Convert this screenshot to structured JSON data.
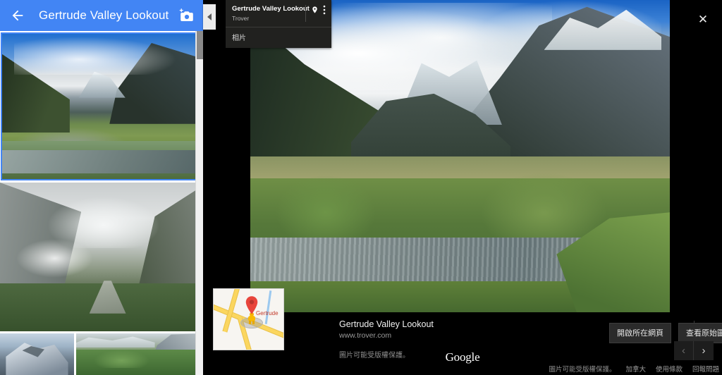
{
  "app": {
    "title": "Gertrude Valley Lookout",
    "back_icon": "back-arrow-icon",
    "add_photo_icon": "add-photo-camera-icon",
    "header_color": "#4285f4"
  },
  "sidebar": {
    "thumbnails": [
      {
        "alt": "Gertrude Valley green alpine valley with stream",
        "selected": true
      },
      {
        "alt": "Misty cliffs and winding road in valley",
        "selected": false
      },
      {
        "alt": "Snow covered mountain peak",
        "selected": false
      },
      {
        "alt": "Beech forest with mountains behind",
        "selected": false
      }
    ],
    "scrollbar": {
      "name": "sidebar-scrollbar"
    }
  },
  "viewer": {
    "close_label": "✕",
    "collapse_tab_icon": "chevron-left-icon",
    "info_card": {
      "title": "Gertrude Valley Lookout",
      "subtitle": "Trover",
      "place_icon": "map-pin-icon",
      "menu_icon": "more-vertical-icon",
      "tab_label": "相片"
    },
    "main_photo": {
      "alt": "Gertrude Valley Lookout panorama with river and mountains"
    },
    "attribution": {
      "title": "Gertrude Valley Lookout",
      "url": "www.trover.com",
      "copyright": "圖片可能受版權保護。",
      "buttons": [
        {
          "label": "開啟所在網頁",
          "name": "open-source-page-button"
        },
        {
          "label": "查看原始圖片",
          "name": "view-original-image-button"
        }
      ]
    },
    "google_logo": "Google",
    "minimap": {
      "label": "Gertrude",
      "pin_icon": "map-marker-icon",
      "pegman_icon": "pegman-icon"
    },
    "footer": {
      "copyright": "圖片可能受版權保護。",
      "links": [
        {
          "label": "加拿大",
          "name": "footer-link-country"
        },
        {
          "label": "使用條款",
          "name": "footer-link-terms"
        },
        {
          "label": "回報問題",
          "name": "footer-link-report"
        }
      ]
    },
    "nav": {
      "prev_label": "‹",
      "next_label": "›"
    }
  },
  "colors": {
    "accent": "#4285f4",
    "panel_dark": "#21211f",
    "page_bg": "#000000"
  }
}
